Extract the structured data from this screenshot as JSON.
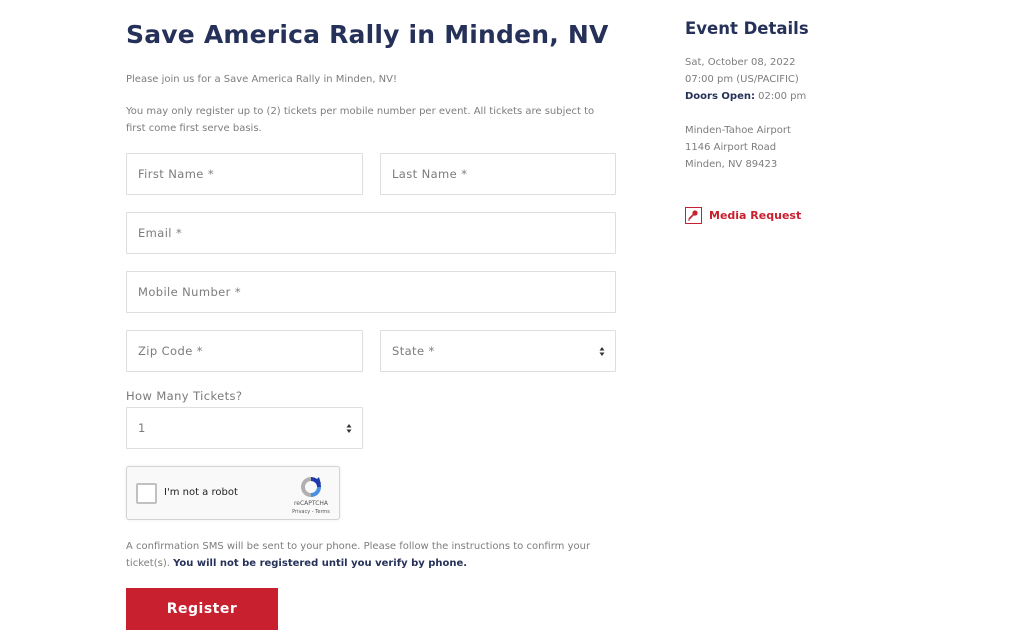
{
  "event": {
    "title": "Save America Rally in Minden, NV",
    "intro": "Please join us for a Save America Rally in Minden, NV!",
    "notice": "You may only register up to (2) tickets per mobile number per event. All tickets are subject to first come first serve basis."
  },
  "form": {
    "first_name_placeholder": "First Name *",
    "last_name_placeholder": "Last Name *",
    "email_placeholder": "Email *",
    "mobile_placeholder": "Mobile Number *",
    "zip_placeholder": "Zip Code *",
    "state_placeholder": "State *",
    "tickets_label": "How Many Tickets?",
    "tickets_value": "1",
    "captcha": {
      "label": "I'm not a robot",
      "brand": "reCAPTCHA",
      "terms": "Privacy - Terms",
      "checked": false
    },
    "confirm_text": "A confirmation SMS will be sent to your phone. Please follow the instructions to confirm your ticket(s).",
    "confirm_bold": "You will not be registered until you verify by phone.",
    "register_label": "Register"
  },
  "details": {
    "title": "Event Details",
    "date": "Sat, October 08, 2022",
    "time": "07:00 pm (US/PACIFIC)",
    "doors_label": "Doors Open:",
    "doors_time": "02:00 pm",
    "venue": "Minden-Tahoe Airport",
    "address1": "1146 Airport Road",
    "address2": "Minden, NV 89423",
    "media_icon": "microphone-icon",
    "media_label": "Media Request"
  },
  "colors": {
    "navy": "#263159",
    "red": "#c8202f",
    "text": "#7d7d7d",
    "border": "#dedede"
  }
}
